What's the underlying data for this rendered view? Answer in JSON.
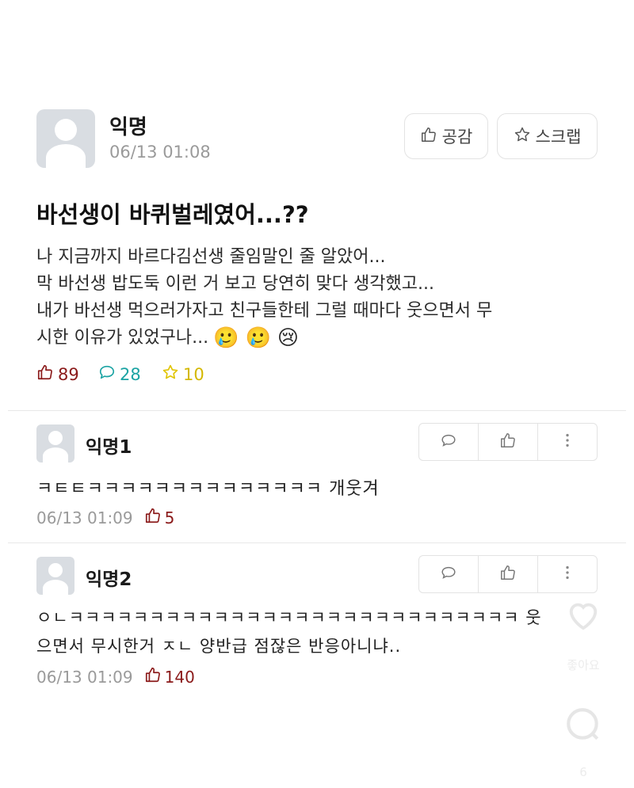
{
  "post": {
    "author": "익명",
    "timestamp": "06/13 01:08",
    "empathy_label": "공감",
    "scrap_label": "스크랩",
    "title": "바선생이 바퀴벌레였어...??",
    "body_lines": [
      "나 지금까지 바르다김선생 줄임말인 줄 알았어...",
      "막 바선생 밥도둑 이런 거 보고 당연히 맞다 생각했고...",
      "내가 바선생 먹으러가자고 친구들한테 그럴 때마다 웃으면서 무",
      "시한 이유가 있었구나..."
    ],
    "emojis": [
      "🥲",
      "🥲",
      "😢"
    ],
    "stats": {
      "likes": "89",
      "comments": "28",
      "scraps": "10"
    }
  },
  "comments": [
    {
      "author": "익명1",
      "lines": [
        "ㅋㅌㅌㅋㅋㅋㅋㅋㅋㅋㅋㅋㅋㅋㅋㅋㅋ 개웃겨"
      ],
      "timestamp": "06/13 01:09",
      "likes": "5"
    },
    {
      "author": "익명2",
      "lines": [
        "ㅇㄴㅋㅋㅋㅋㅋㅋㅋㅋㅋㅋㅋㅋㅋㅋㅋㅋㅋㅋㅋㅋㅋㅋㅋㅋㅋㅋㅋㅋ 웃",
        "으면서 무시한거 ㅈㄴ 양반급 점잖은 반응아니냐.."
      ],
      "timestamp": "06/13 01:09",
      "likes": "140"
    }
  ],
  "overlay": {
    "like_label": "좋아요",
    "comment_count": "6"
  },
  "colors": {
    "like": "#8b1a1a",
    "comment": "#1aa3a3",
    "scrap": "#e0c400",
    "meta": "#9a9a9a"
  }
}
